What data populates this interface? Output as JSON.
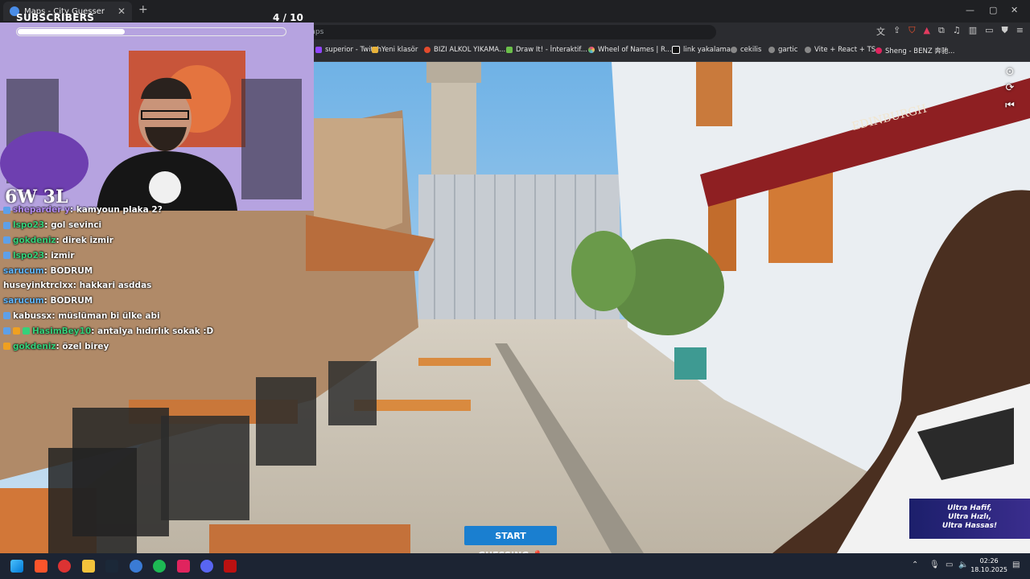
{
  "browser": {
    "tab_title": "Maps - City Guesser",
    "new_tab": "+",
    "url": "virtualvacation.us/maps",
    "window_controls": [
      "—",
      "▢",
      "✕"
    ]
  },
  "bookmarks": [
    {
      "label": "superior - Twitch",
      "color": "#9146ff"
    },
    {
      "label": "Yeni klasör",
      "color": "#e8b23a"
    },
    {
      "label": "BIZI ALKOL YIKAMA...",
      "color": "#e34b2d"
    },
    {
      "label": "Draw It! - İnteraktif...",
      "color": "#6bbf4a"
    },
    {
      "label": "Wheel of Names | R...",
      "color": "#e83f7a"
    },
    {
      "label": "link yakalama",
      "color": "#ffffff"
    },
    {
      "label": "cekilis",
      "color": "#cccccc"
    },
    {
      "label": "gartic",
      "color": "#cccccc"
    },
    {
      "label": "Vite + React + TS",
      "color": "#cccccc"
    },
    {
      "label": "Sheng - BENZ 奔驰...",
      "color": "#e0245e"
    }
  ],
  "stream": {
    "subscribers_label": "SUBSCRIBERS",
    "subscribers_progress": 0.4,
    "round": "4  / 10",
    "win_loss": "6W 3L"
  },
  "chat": [
    {
      "user": "sheparder y",
      "user_color": "#b48cf2",
      "msg": "kamyoun plaka 2?"
    },
    {
      "user": "lspo23",
      "user_color": "#35d17a",
      "msg": "gol sevinci"
    },
    {
      "user": "gokdeniz",
      "user_color": "#35d17a",
      "msg": "direk izmir"
    },
    {
      "user": "lspo23",
      "user_color": "#35d17a",
      "msg": "izmir"
    },
    {
      "user": "sarucum",
      "user_color": "#5fb6ff",
      "msg": "BODRUM"
    },
    {
      "user": "huseyinktrclxx",
      "user_color": "#ffffff",
      "msg": "hakkari asddas"
    },
    {
      "user": "sarucum",
      "user_color": "#5fb6ff",
      "msg": "BODRUM"
    },
    {
      "user": "kabussx",
      "user_color": "#ffffff",
      "msg": "müslüman bi ülke abi"
    },
    {
      "user": "HasimBey10",
      "user_color": "#35d17a",
      "msg": "antalya hıdırlık sokak :D"
    },
    {
      "user": "gokdeniz",
      "user_color": "#35d17a",
      "msg": "özel birey"
    }
  ],
  "controls": {
    "start_guessing": "START GUESSING 📍",
    "compass_icon": "compass-icon",
    "refresh_icon": "refresh-icon",
    "back_icon": "skip-back-icon"
  },
  "ad": {
    "line1": "Ultra Hafif,",
    "line2": "Ultra Hızlı,",
    "line3": "Ultra Hassas!"
  },
  "scene": {
    "sign": "EDINBURGH"
  },
  "taskbar": {
    "time": "02:26",
    "date": "18.10.2025"
  }
}
